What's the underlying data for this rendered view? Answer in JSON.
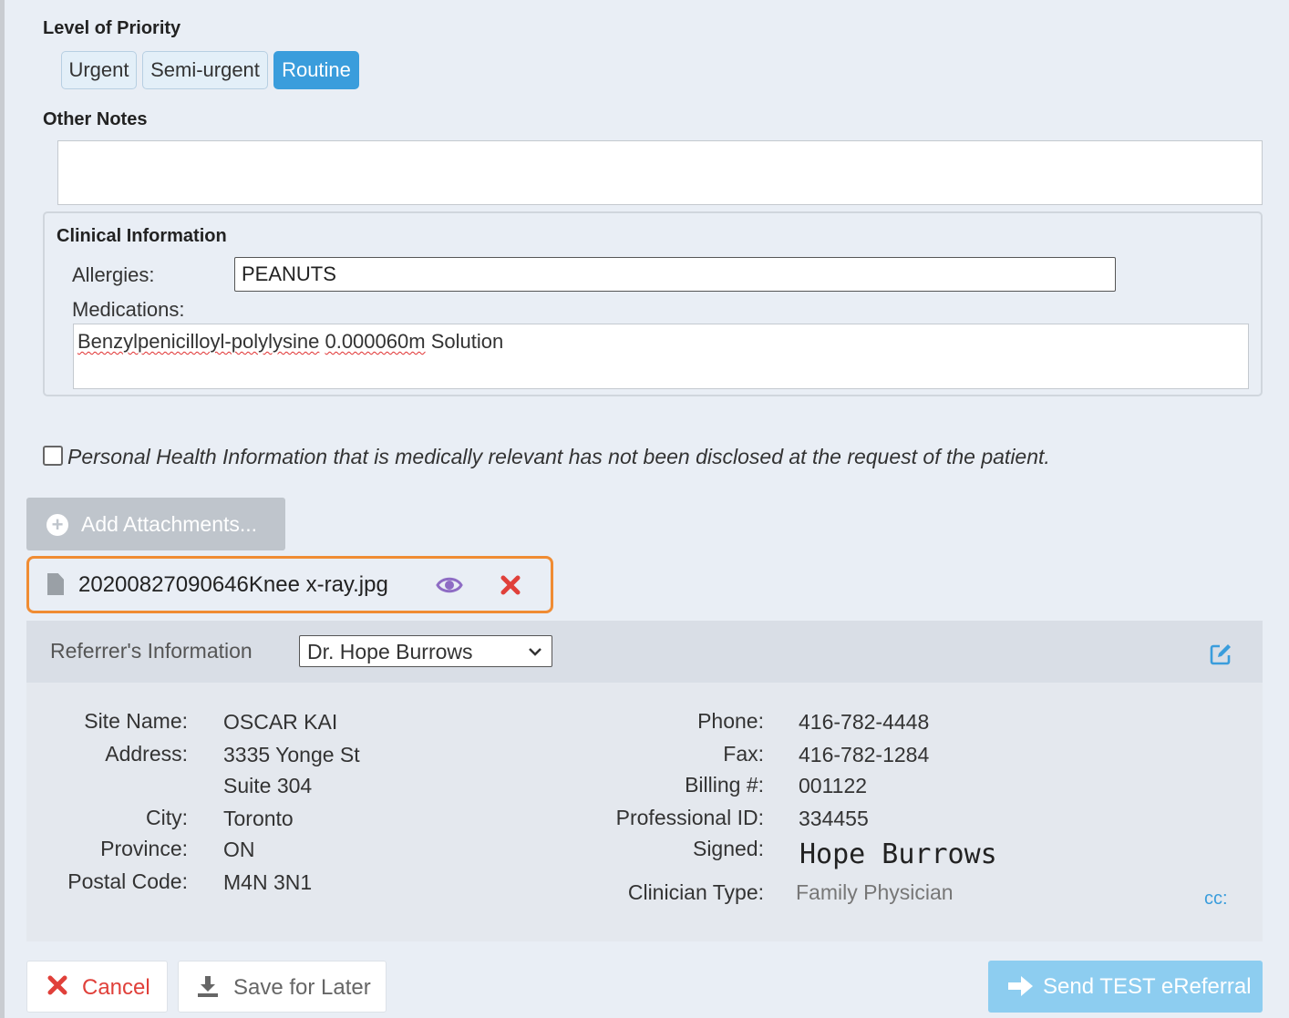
{
  "priority": {
    "label": "Level of Priority",
    "options": [
      "Urgent",
      "Semi-urgent",
      "Routine"
    ],
    "selected": "Routine"
  },
  "other_notes": {
    "label": "Other Notes",
    "value": ""
  },
  "clinical": {
    "title": "Clinical Information",
    "allergies_label": "Allergies:",
    "allergies_value": "PEANUTS",
    "medications_label": "Medications:",
    "medications_part1": "Benzylpenicilloyl-polylysine",
    "medications_part2": "0.000060m",
    "medications_part3": "Solution"
  },
  "phi_checkbox": {
    "checked": false,
    "label": "Personal Health Information that is medically relevant has not been disclosed at the request of the patient."
  },
  "attachments": {
    "add_label": "Add Attachments...",
    "files": [
      {
        "name": "20200827090646Knee x-ray.jpg"
      }
    ]
  },
  "referrer": {
    "section_label": "Referrer's Information",
    "selected": "Dr. Hope Burrows",
    "site_name_label": "Site Name:",
    "site_name": "OSCAR KAI",
    "address_label": "Address:",
    "address_line1": "3335 Yonge St",
    "address_line2": "Suite 304",
    "city_label": "City:",
    "city": "Toronto",
    "province_label": "Province:",
    "province": "ON",
    "postal_label": "Postal Code:",
    "postal": "M4N 3N1",
    "phone_label": "Phone:",
    "phone": "416-782-4448",
    "fax_label": "Fax:",
    "fax": "416-782-1284",
    "billing_label": "Billing #:",
    "billing": "001122",
    "professional_id_label": "Professional ID:",
    "professional_id": "334455",
    "signed_label": "Signed:",
    "signature": "Hope Burrows",
    "clinician_type_label": "Clinician Type:",
    "clinician_type": "Family Physician",
    "cc_label": "cc:"
  },
  "footer": {
    "cancel_label": "Cancel",
    "save_label": "Save for Later",
    "send_label": "Send TEST eReferral"
  },
  "colors": {
    "accent": "#3a9ddc",
    "highlight_border": "#f08c33",
    "danger": "#e0403a",
    "eye": "#8e6cc4",
    "send_button": "#8dcdf0"
  }
}
